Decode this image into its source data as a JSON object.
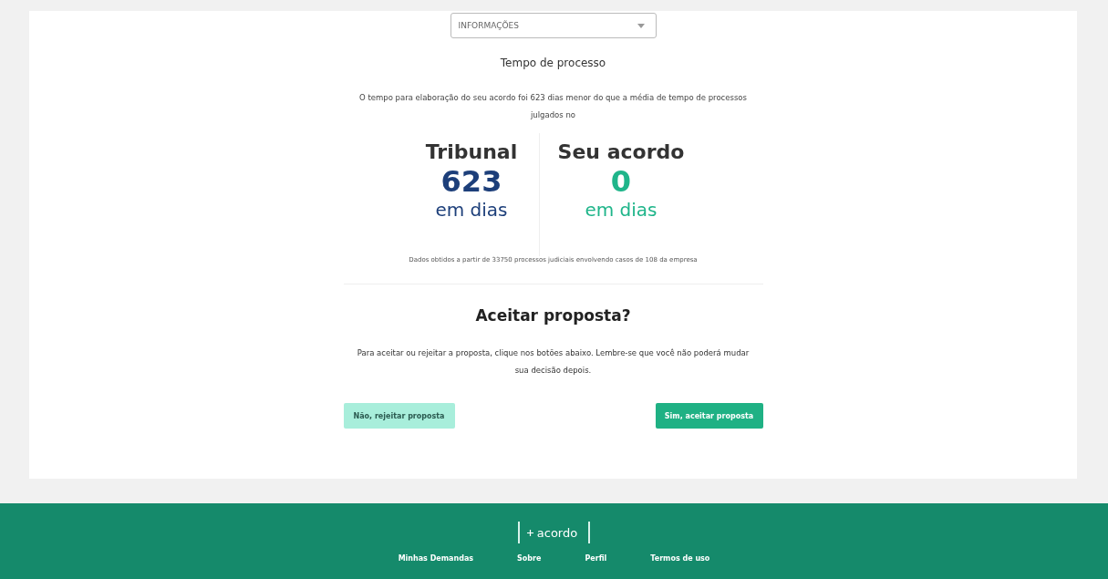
{
  "select": {
    "value": "INFORMAÇÕES"
  },
  "process_time": {
    "title": "Tempo de processo",
    "description": "O tempo para elaboração do seu acordo foi 623 dias menor do que a média de tempo de processos julgados no",
    "stats": [
      {
        "label": "Tribunal",
        "value": "623",
        "unit": "em dias",
        "color": "#1d3f7a"
      },
      {
        "label": "Seu acordo",
        "value": "0",
        "unit": "em dias",
        "color": "#1fb58a"
      }
    ],
    "footnote": "Dados obtidos a partir de 33750 processos judiciais envolvendo casos de 108 da empresa"
  },
  "proposal": {
    "title": "Aceitar proposta?",
    "description": "Para aceitar ou rejeitar a proposta, clique nos botões abaixo. Lembre-se que você não poderá mudar sua decisão depois.",
    "buttons": [
      {
        "label": "Não, rejeitar proposta",
        "kind": "secondary"
      },
      {
        "label": "Sim, aceitar proposta",
        "kind": "primary"
      }
    ]
  },
  "footer": {
    "logo": "acordo",
    "links": [
      "Minhas Demandas",
      "Sobre",
      "Perfil",
      "Termos de uso"
    ]
  }
}
